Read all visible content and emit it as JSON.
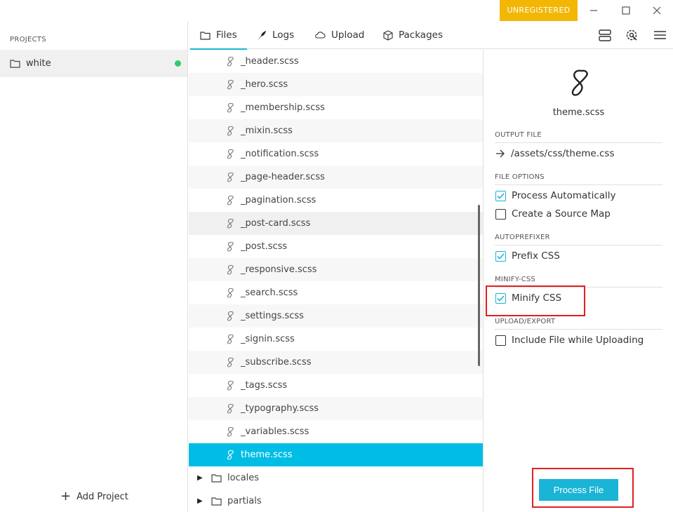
{
  "titlebar": {
    "badge": "UNREGISTERED"
  },
  "sidebar": {
    "section_label": "PROJECTS",
    "project": {
      "name": "white",
      "status_color": "#2ecc71"
    },
    "add_label": "Add Project"
  },
  "tabs": [
    {
      "label": "Files",
      "icon": "folder-icon"
    },
    {
      "label": "Logs",
      "icon": "feather-icon"
    },
    {
      "label": "Upload",
      "icon": "cloud-icon"
    },
    {
      "label": "Packages",
      "icon": "package-icon"
    }
  ],
  "files": [
    "_header.scss",
    "_hero.scss",
    "_membership.scss",
    "_mixin.scss",
    "_notification.scss",
    "_page-header.scss",
    "_pagination.scss",
    "_post-card.scss",
    "_post.scss",
    "_responsive.scss",
    "_search.scss",
    "_settings.scss",
    "_signin.scss",
    "_subscribe.scss",
    "_tags.scss",
    "_typography.scss",
    "_variables.scss",
    "theme.scss"
  ],
  "folders": [
    "locales",
    "partials"
  ],
  "panel": {
    "file_name": "theme.scss",
    "output_label": "OUTPUT FILE",
    "output_path": "/assets/css/theme.css",
    "file_options_label": "FILE OPTIONS",
    "process_auto": "Process Automatically",
    "source_map": "Create a Source Map",
    "autoprefixer_label": "AUTOPREFIXER",
    "prefix_css": "Prefix CSS",
    "minify_label": "MINIFY-CSS",
    "minify_css": "Minify CSS",
    "upload_label": "UPLOAD/EXPORT",
    "include_upload": "Include File while Uploading",
    "process_button": "Process File"
  },
  "colors": {
    "accent": "#1ab4d6",
    "selected_row": "#00bde6",
    "badge": "#f2b705",
    "highlight": "#e02020"
  }
}
